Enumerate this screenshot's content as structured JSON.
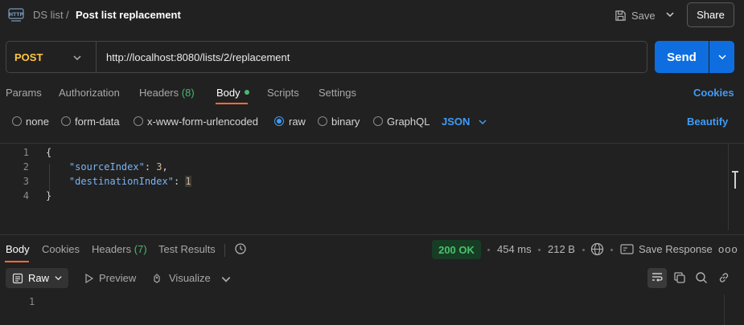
{
  "header": {
    "icon": "http-request-icon",
    "breadcrumb_parent": "DS list",
    "breadcrumb_separator": "/",
    "title": "Post list replacement",
    "save_label": "Save",
    "share_label": "Share"
  },
  "request": {
    "method": "POST",
    "method_color": "#ffc53d",
    "url": "http://localhost:8080/lists/2/replacement",
    "send_label": "Send",
    "accent": "#0e6ee0"
  },
  "request_tabs": {
    "params": "Params",
    "authorization": "Authorization",
    "headers": "Headers",
    "headers_count": "(8)",
    "body": "Body",
    "scripts": "Scripts",
    "settings": "Settings",
    "cookies": "Cookies",
    "active": "Body"
  },
  "body_types": {
    "none": "none",
    "form_data": "form-data",
    "urlencoded": "x-www-form-urlencoded",
    "raw": "raw",
    "binary": "binary",
    "graphql": "GraphQL",
    "selected": "raw",
    "format": "JSON",
    "beautify": "Beautify"
  },
  "editor": {
    "lines": [
      {
        "no": "1",
        "text": "{"
      },
      {
        "no": "2",
        "key": "\"sourceIndex\"",
        "sep": ": ",
        "value": "3",
        "end": ","
      },
      {
        "no": "3",
        "key": "\"destinationIndex\"",
        "sep": ": ",
        "value": "1",
        "end": ""
      },
      {
        "no": "4",
        "text": "}"
      }
    ]
  },
  "response": {
    "tabs": {
      "body": "Body",
      "cookies": "Cookies",
      "headers": "Headers",
      "headers_count": "(7)",
      "test_results": "Test Results",
      "active": "Body"
    },
    "status": "200 OK",
    "status_color": "#4ac26b",
    "time": "454 ms",
    "size": "212 B",
    "save_response": "Save Response",
    "more": "ooo",
    "view": {
      "raw": "Raw",
      "preview": "Preview",
      "visualize": "Visualize"
    },
    "line_number": "1"
  }
}
